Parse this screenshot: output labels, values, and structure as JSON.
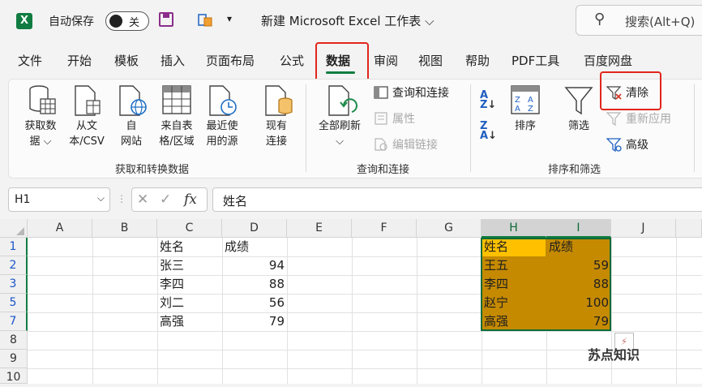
{
  "app": {
    "logo_letter": "X",
    "autosave_label": "自动保存",
    "autosave_state": "关",
    "title": "新建 Microsoft Excel 工作表 ⌵",
    "search_placeholder": "搜索(Alt+Q)"
  },
  "tabs": [
    "文件",
    "开始",
    "模板",
    "插入",
    "页面布局",
    "公式",
    "数据",
    "审阅",
    "视图",
    "帮助",
    "PDF工具",
    "百度网盘"
  ],
  "active_tab": "数据",
  "ribbon": {
    "get_transform": {
      "label": "获取和转换数据",
      "items": [
        "获取数\n据 ⌵",
        "从文\n本/CSV",
        "自\n网站",
        "来自表\n格/区域",
        "最近使\n用的源",
        "现有\n连接"
      ]
    },
    "queries": {
      "label": "查询和连接",
      "refresh_all": "全部刷新\n⌵",
      "items": [
        "查询和连接",
        "属性",
        "编辑链接"
      ]
    },
    "sort_filter": {
      "label": "排序和筛选",
      "sort": "排序",
      "filter": "筛选",
      "clear": "清除",
      "reapply": "重新应用",
      "advanced": "高级"
    }
  },
  "formula_bar": {
    "name_box": "H1",
    "cancel": "✕",
    "enter": "✓",
    "fx": "fx",
    "content": "姓名"
  },
  "grid": {
    "columns": [
      "A",
      "B",
      "C",
      "D",
      "E",
      "F",
      "G",
      "H",
      "I",
      "J"
    ],
    "selected_columns": [
      "H",
      "I"
    ],
    "rows": [
      {
        "num": "1",
        "C": "姓名",
        "D": "成绩",
        "H": "姓名",
        "I": "成绩"
      },
      {
        "num": "2",
        "C": "张三",
        "D": "94",
        "H": "王五",
        "I": "59"
      },
      {
        "num": "3",
        "C": "李四",
        "D": "88",
        "H": "李四",
        "I": "88"
      },
      {
        "num": "5",
        "C": "刘二",
        "D": "56",
        "H": "赵宁",
        "I": "100"
      },
      {
        "num": "7",
        "C": "高强",
        "D": "79",
        "H": "高强",
        "I": "79"
      },
      {
        "num": "8"
      },
      {
        "num": "9"
      },
      {
        "num": "10"
      }
    ]
  },
  "watermark": "苏点知识",
  "colors": {
    "excel_green": "#107c41",
    "selection_fill": "#c58a00",
    "header_highlight": "#ffc000",
    "callout_red": "#e1261c"
  }
}
